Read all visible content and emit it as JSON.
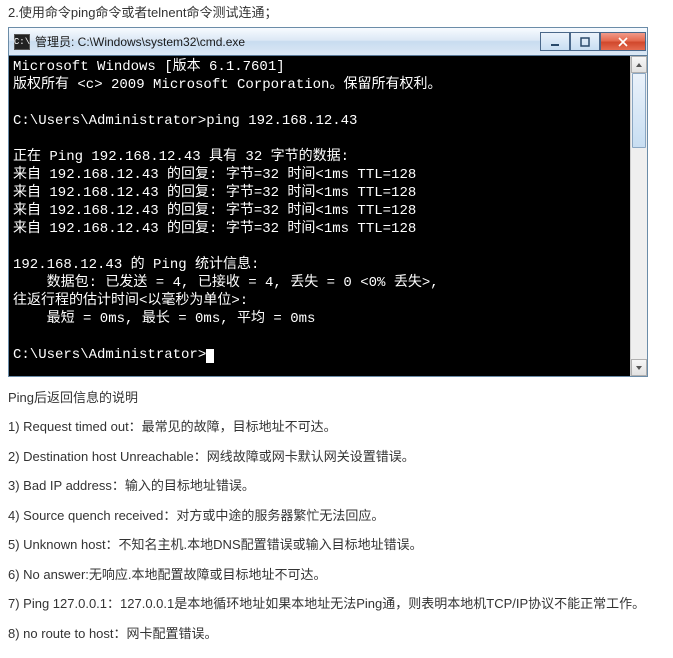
{
  "doc": {
    "step_header": "2.使用命令ping命令或者telnent命令测试连通；",
    "explain_title": "Ping后返回信息的说明",
    "explain_items": [
      "1) Request timed out：最常见的故障，目标地址不可达。",
      "2) Destination host Unreachable：网线故障或网卡默认网关设置错误。",
      "3) Bad IP address：输入的目标地址错误。",
      "4) Source quench received：对方或中途的服务器繁忙无法回应。",
      "5) Unknown host：不知名主机.本地DNS配置错误或输入目标地址错误。",
      "6) No answer:无响应.本地配置故障或目标地址不可达。",
      "7) Ping 127.0.0.1：127.0.0.1是本地循环地址如果本地址无法Ping通，则表明本地机TCP/IP协议不能正常工作。",
      "8) no route to host：网卡配置错误。"
    ]
  },
  "window": {
    "icon_text": "C:\\",
    "title": "管理员: C:\\Windows\\system32\\cmd.exe"
  },
  "console": {
    "lines": [
      "Microsoft Windows [版本 6.1.7601]",
      "版权所有 <c> 2009 Microsoft Corporation。保留所有权利。",
      "",
      "C:\\Users\\Administrator>ping 192.168.12.43",
      "",
      "正在 Ping 192.168.12.43 具有 32 字节的数据:",
      "来自 192.168.12.43 的回复: 字节=32 时间<1ms TTL=128",
      "来自 192.168.12.43 的回复: 字节=32 时间<1ms TTL=128",
      "来自 192.168.12.43 的回复: 字节=32 时间<1ms TTL=128",
      "来自 192.168.12.43 的回复: 字节=32 时间<1ms TTL=128",
      "",
      "192.168.12.43 的 Ping 统计信息:",
      "    数据包: 已发送 = 4, 已接收 = 4, 丢失 = 0 <0% 丢失>,",
      "往返行程的估计时间<以毫秒为单位>:",
      "    最短 = 0ms, 最长 = 0ms, 平均 = 0ms",
      "",
      "C:\\Users\\Administrator>_"
    ],
    "prompt_prefix": "C:\\Users\\Administrator>"
  }
}
